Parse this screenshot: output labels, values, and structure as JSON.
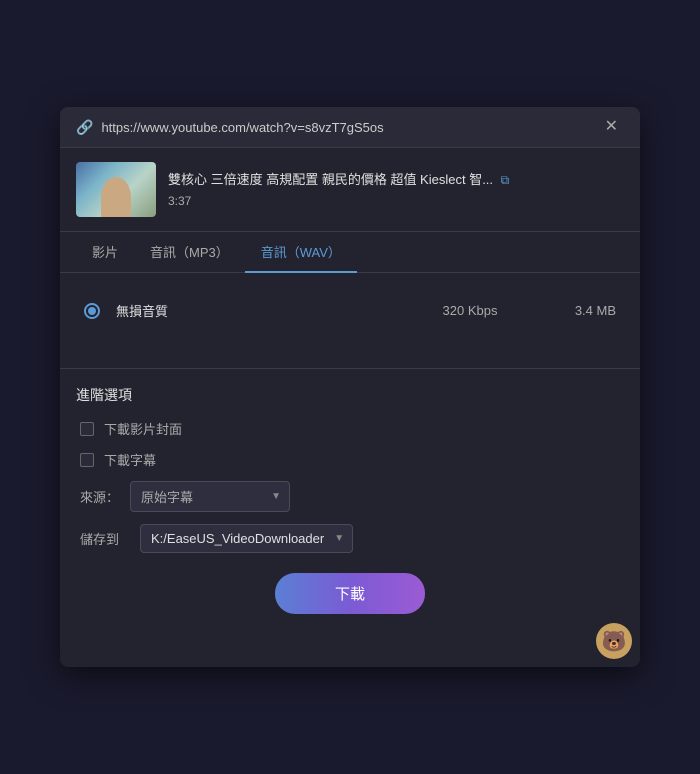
{
  "dialog": {
    "url": "https://www.youtube.com/watch?v=s8vzT7gS5os",
    "close_label": "✕"
  },
  "video": {
    "title": "雙核心 三倍速度 高規配置 親民的價格 超值 Kieslect 智...",
    "duration": "3:37",
    "external_link_icon": "⧉"
  },
  "tabs": [
    {
      "id": "video",
      "label": "影片",
      "active": false
    },
    {
      "id": "mp3",
      "label": "音訊（MP3）",
      "active": false
    },
    {
      "id": "wav",
      "label": "音訊（WAV）",
      "active": true
    }
  ],
  "qualities": [
    {
      "label": "無損音質",
      "bitrate": "320 Kbps",
      "size": "3.4 MB",
      "selected": true
    }
  ],
  "advanced": {
    "title": "進階選項",
    "options": [
      {
        "label": "下載影片封面",
        "checked": false
      },
      {
        "label": "下載字幕",
        "checked": false
      }
    ],
    "source_label": "來源：",
    "source_value": "原始字幕",
    "save_label": "儲存到",
    "save_path": "K:/EaseUS_VideoDownloader"
  },
  "download_button": {
    "label": "下載"
  }
}
